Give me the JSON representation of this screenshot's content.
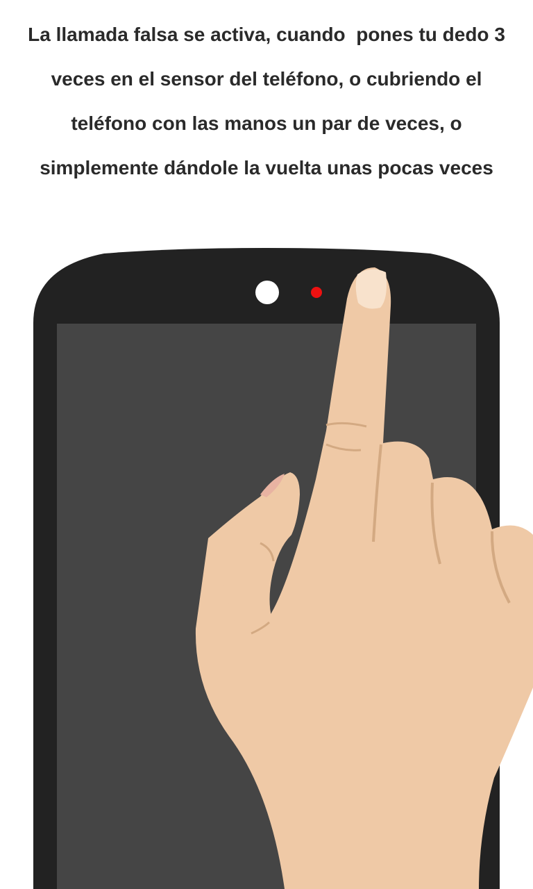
{
  "instruction": {
    "text": "La llamada falsa se activa, cuando  pones tu dedo 3 veces en el sensor del teléfono, o cubriendo el teléfono con las manos un par de veces, o simplemente dándole la vuelta unas pocas veces"
  },
  "illustration": {
    "phone_body_color": "#222222",
    "screen_color": "#454545",
    "camera_color": "#ffffff",
    "sensor_color": "#ee1111",
    "skin_color": "#efc9a6",
    "skin_crease_color": "#d3a982",
    "nail_color": "#f8e2cc"
  }
}
